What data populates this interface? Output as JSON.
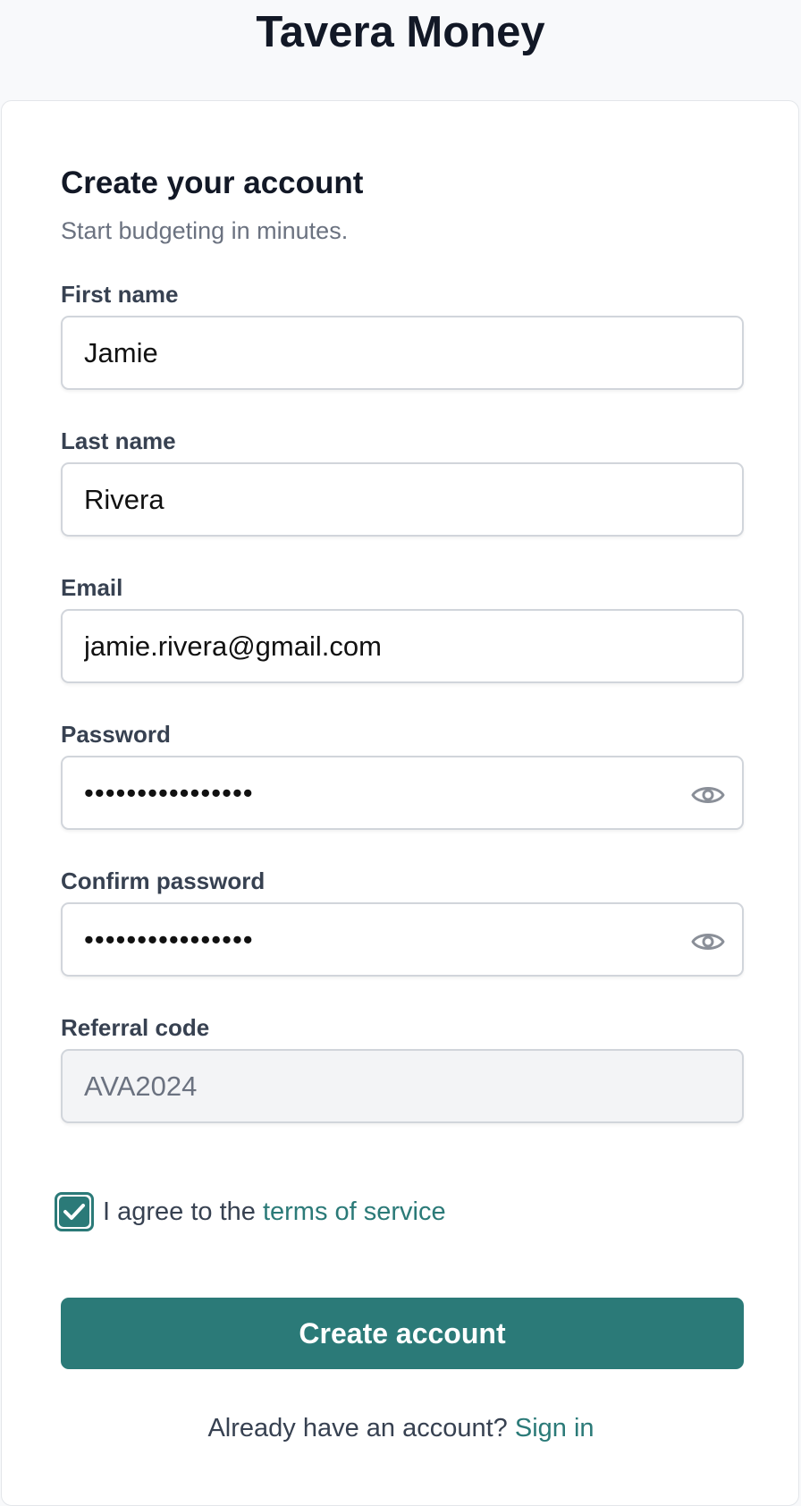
{
  "app": {
    "title": "Tavera Money"
  },
  "form": {
    "heading": "Create your account",
    "subheading": "Start budgeting in minutes.",
    "fields": {
      "first_name": {
        "label": "First name",
        "value": "Jamie"
      },
      "last_name": {
        "label": "Last name",
        "value": "Rivera"
      },
      "email": {
        "label": "Email",
        "value": "jamie.rivera@gmail.com"
      },
      "password": {
        "label": "Password",
        "value": "••••••••••••••••"
      },
      "confirm_password": {
        "label": "Confirm password",
        "value": "••••••••••••••••"
      },
      "referral_code": {
        "label": "Referral code",
        "value": "AVA2024"
      }
    },
    "terms": {
      "checked": true,
      "prefix": "I agree to the ",
      "link_label": "terms of service"
    },
    "submit_label": "Create account",
    "footer": {
      "prompt": "Already have an account? ",
      "link_label": "Sign in"
    }
  },
  "icons": {
    "password_toggle": "eye-icon",
    "confirm_password_toggle": "eye-icon",
    "checkbox_mark": "checkmark-icon"
  },
  "colors": {
    "accent": "#2b7a78",
    "background": "#f8f9fb",
    "card": "#ffffff",
    "disabled_field": "#f3f4f6"
  }
}
